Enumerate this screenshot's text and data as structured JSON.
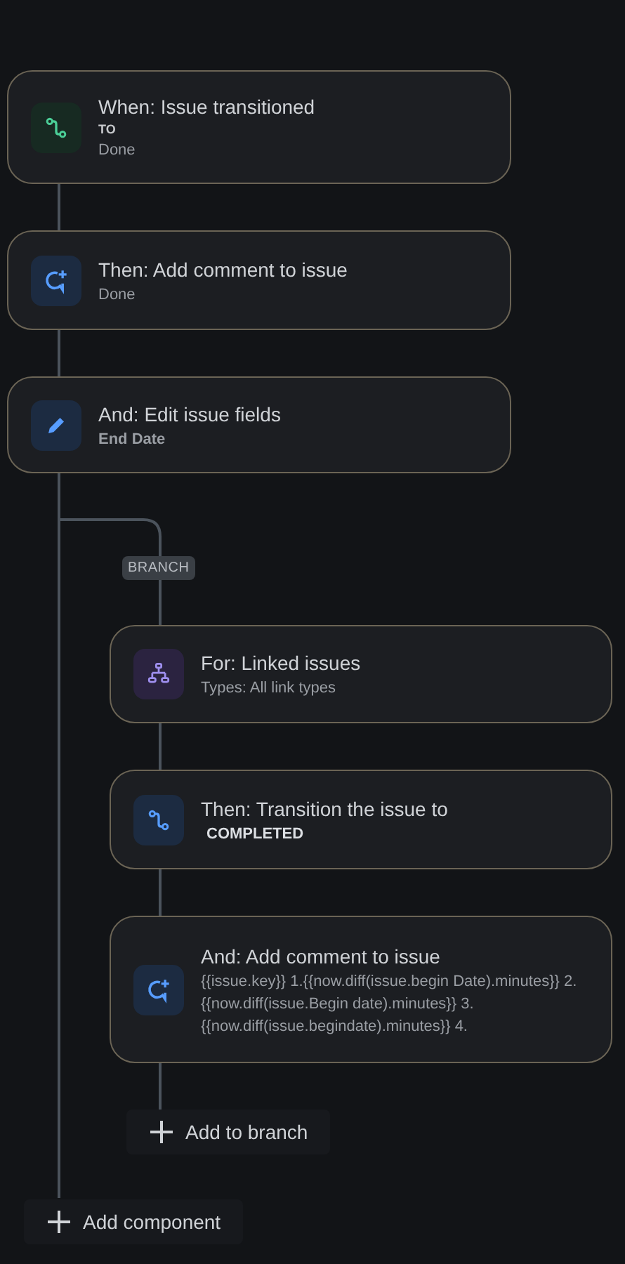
{
  "rule": [
    {
      "kind": "trigger",
      "title": "When: Issue transitioned",
      "label": "TO",
      "value": "Done"
    },
    {
      "kind": "comment",
      "title": "Then: Add comment to issue",
      "value": "Done"
    },
    {
      "kind": "edit",
      "title": "And: Edit issue fields",
      "field": "End Date"
    }
  ],
  "branch": {
    "badge": "BRANCH",
    "steps": [
      {
        "kind": "branch",
        "title": "For: Linked issues",
        "value": "Types: All link types"
      },
      {
        "kind": "transition",
        "title": "Then: Transition the issue to",
        "status": "COMPLETED"
      },
      {
        "kind": "comment",
        "title": "And: Add comment to issue",
        "value": "{{issue.key}} 1.{{now.diff(issue.begin Date).minutes}} 2.{{now.diff(issue.Begin date).minutes}} 3. {{now.diff(issue.begindate).minutes}} 4."
      }
    ],
    "add_button": "Add to branch"
  },
  "add_button": "Add component"
}
